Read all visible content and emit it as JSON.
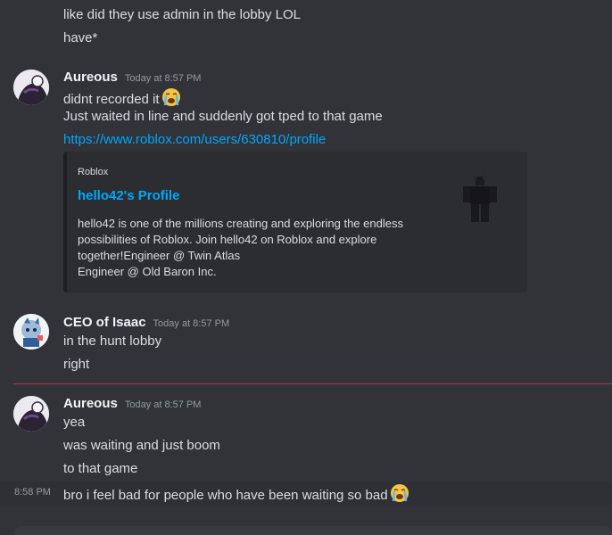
{
  "messages": {
    "top_line_1": "like did they use admin in the lobby LOL",
    "top_line_2": "have*",
    "group1": {
      "username": "Aureous",
      "timestamp": "Today at 8:57 PM",
      "line1": "didnt recorded it",
      "line2": "Just waited in line and suddenly got tped to that game",
      "link": "https://www.roblox.com/users/630810/profile",
      "embed": {
        "provider": "Roblox",
        "title": "hello42's Profile",
        "description": "hello42 is one of the millions creating and exploring the endless\npossibilities of Roblox. Join hello42 on Roblox and explore\ntogether!Engineer @ Twin Atlas\nEngineer @ Old Baron Inc."
      }
    },
    "group2": {
      "username": "CEO of Isaac",
      "timestamp": "Today at 8:57 PM",
      "line1": "in the hunt lobby",
      "line2": "right"
    },
    "group3": {
      "username": "Aureous",
      "timestamp": "Today at 8:57 PM",
      "line1": "yea",
      "line2": "was waiting and just boom",
      "line3": "to that game",
      "line4_time": "8:58 PM",
      "line4": "bro i feel bad for people who have been waiting so bad"
    }
  },
  "icons": {
    "crying_emoji": "loudly-crying-face-icon"
  },
  "colors": {
    "background": "#313338",
    "link": "#00a8fc",
    "new_divider": "#c03537"
  }
}
